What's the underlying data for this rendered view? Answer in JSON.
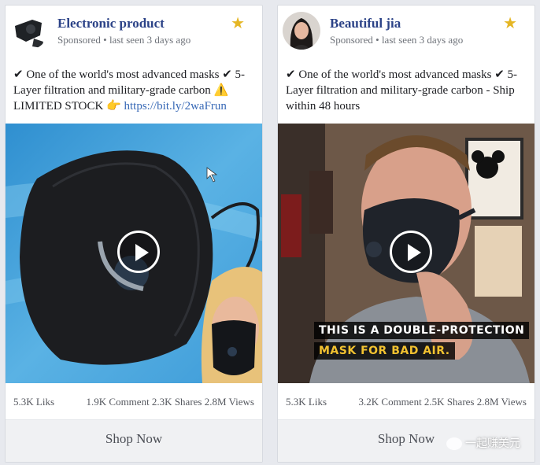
{
  "cards": [
    {
      "page_name": "Electronic product",
      "meta": "Sponsored • last seen 3 days ago",
      "text_main": "✔ One of the world's most advanced masks ✔ 5-Layer filtration and military-grade carbon ⚠️ LIMITED STOCK 👉 ",
      "link": "https://bit.ly/2waFrun",
      "likes": "5.3K Liks",
      "engagement": "1.9K Comment 2.3K Shares 2.8M Views",
      "cta": "Shop Now",
      "star_icon": "star-icon"
    },
    {
      "page_name": "Beautiful jia",
      "meta": "Sponsored • last seen 3 days ago",
      "text_main": "✔ One of the world's most advanced masks ✔ 5-Layer filtration and military-grade carbon - Ship within 48 hours",
      "video_caption_line1": "THIS IS A DOUBLE-PROTECTION",
      "video_caption_line2": "MASK FOR BAD AIR.",
      "likes": "5.3K Liks",
      "engagement": "3.2K Comment 2.5K Shares 2.8M Views",
      "cta": "Shop Now",
      "star_icon": "star-icon"
    }
  ],
  "watermark": "一起赚美元",
  "colors": {
    "page_name": "#2b4287",
    "link": "#3869b6",
    "star": "#e5b624",
    "caption_yellow": "#f2c230"
  }
}
